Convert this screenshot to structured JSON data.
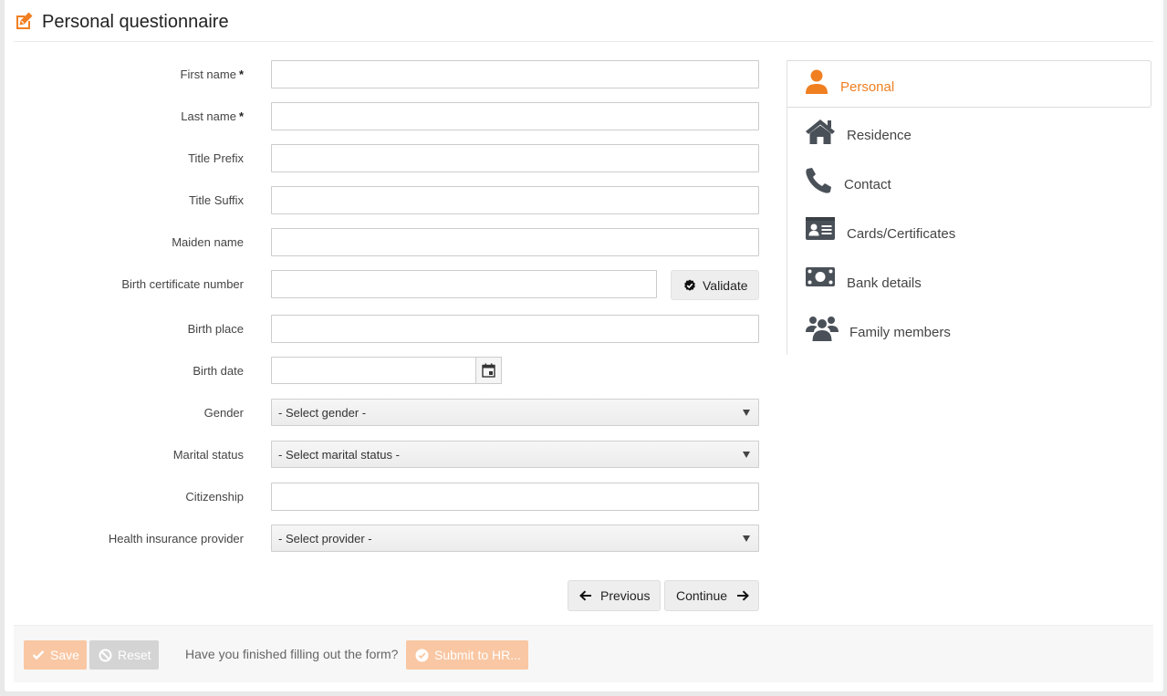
{
  "header": {
    "title": "Personal questionnaire"
  },
  "colors": {
    "accent": "#f07f22",
    "icon_dark": "#4a5058"
  },
  "form": {
    "first_name": {
      "label": "First name",
      "required": "*",
      "value": ""
    },
    "last_name": {
      "label": "Last name",
      "required": "*",
      "value": ""
    },
    "title_prefix": {
      "label": "Title Prefix",
      "value": ""
    },
    "title_suffix": {
      "label": "Title Suffix",
      "value": ""
    },
    "maiden_name": {
      "label": "Maiden name",
      "value": ""
    },
    "birth_certificate": {
      "label": "Birth certificate number",
      "value": "",
      "validate_label": "Validate"
    },
    "birth_place": {
      "label": "Birth place",
      "value": ""
    },
    "birth_date": {
      "label": "Birth date",
      "value": ""
    },
    "gender": {
      "label": "Gender",
      "selected": "- Select gender -"
    },
    "marital_status": {
      "label": "Marital status",
      "selected": "- Select marital status -"
    },
    "citizenship": {
      "label": "Citizenship",
      "value": ""
    },
    "health_insurance": {
      "label": "Health insurance provider",
      "selected": "- Select provider -"
    }
  },
  "nav": {
    "previous_label": "Previous",
    "continue_label": "Continue"
  },
  "footer": {
    "save_label": "Save",
    "reset_label": "Reset",
    "question": "Have you finished filling out the form?",
    "submit_label": "Submit to HR..."
  },
  "sidebar": {
    "items": [
      {
        "label": "Personal",
        "icon": "user-icon",
        "active": true
      },
      {
        "label": "Residence",
        "icon": "home-icon"
      },
      {
        "label": "Contact",
        "icon": "phone-icon"
      },
      {
        "label": "Cards/Certificates",
        "icon": "id-card-icon"
      },
      {
        "label": "Bank details",
        "icon": "money-icon"
      },
      {
        "label": "Family members",
        "icon": "users-icon"
      }
    ]
  }
}
